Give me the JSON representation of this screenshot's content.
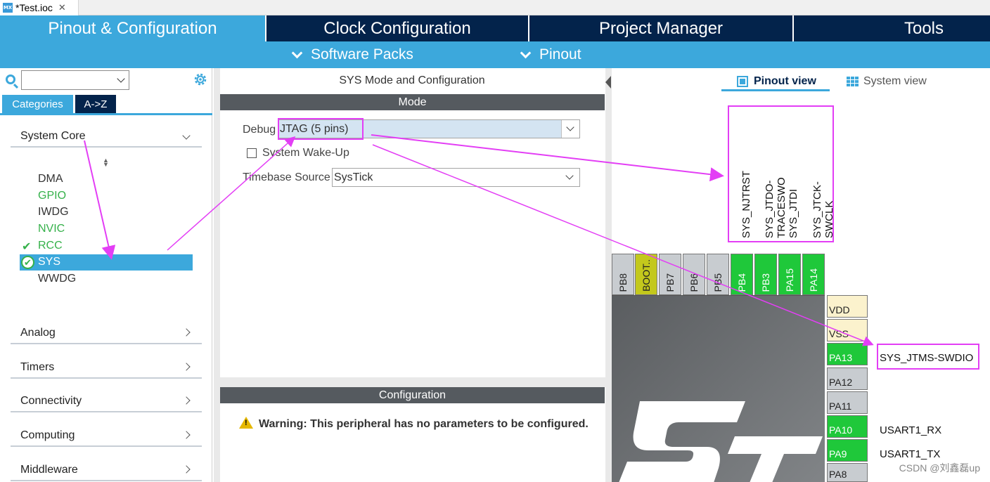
{
  "file_tab": {
    "icon": "mx-icon",
    "icon_text": "MX",
    "title": "*Test.ioc",
    "close": "✕"
  },
  "main_tabs": [
    {
      "label": "Pinout & Configuration",
      "active": true
    },
    {
      "label": "Clock Configuration",
      "active": false
    },
    {
      "label": "Project Manager",
      "active": false
    },
    {
      "label": "Tools",
      "active": false
    }
  ],
  "sub_nav": [
    {
      "label": "Software Packs",
      "icon": "chevron-down-icon"
    },
    {
      "label": "Pinout",
      "icon": "chevron-down-icon"
    }
  ],
  "left": {
    "search_value": "",
    "toggle_categories": "Categories",
    "toggle_az": "A->Z",
    "groups": [
      {
        "label": "System Core",
        "expanded": true
      },
      {
        "label": "Analog",
        "expanded": false
      },
      {
        "label": "Timers",
        "expanded": false
      },
      {
        "label": "Connectivity",
        "expanded": false
      },
      {
        "label": "Computing",
        "expanded": false
      },
      {
        "label": "Middleware",
        "expanded": false
      }
    ],
    "peripherals": [
      {
        "label": "DMA",
        "state": "plain"
      },
      {
        "label": "GPIO",
        "state": "green"
      },
      {
        "label": "IWDG",
        "state": "plain"
      },
      {
        "label": "NVIC",
        "state": "green"
      },
      {
        "label": "RCC",
        "state": "checked"
      },
      {
        "label": "SYS",
        "state": "selected"
      },
      {
        "label": "WWDG",
        "state": "plain"
      }
    ],
    "check_glyph": "✔"
  },
  "middle": {
    "title": "SYS Mode and Configuration",
    "mode_header": "Mode",
    "debug_label": "Debug",
    "debug_value": "JTAG (5 pins)",
    "wakeup_label": "System Wake-Up",
    "wakeup_checked": false,
    "timebase_label": "Timebase Source",
    "timebase_value": "SysTick",
    "config_header": "Configuration",
    "warning": "Warning: This peripheral has no parameters to be configured.",
    "warning_mark": "!"
  },
  "right": {
    "tab_pinout": "Pinout view",
    "tab_system": "System view",
    "top_signal_labels": [
      "SYS_NJTRST",
      "SYS_JTDO-TRACESWO",
      "SYS_JTDI",
      "SYS_JTCK-SWCLK"
    ],
    "top_pins": [
      {
        "label": "PB8",
        "color": "grey"
      },
      {
        "label": "BOOT..",
        "color": "olive"
      },
      {
        "label": "PB7",
        "color": "grey"
      },
      {
        "label": "PB6",
        "color": "grey"
      },
      {
        "label": "PB5",
        "color": "grey"
      },
      {
        "label": "PB4",
        "color": "green"
      },
      {
        "label": "PB3",
        "color": "green"
      },
      {
        "label": "PA15",
        "color": "green"
      },
      {
        "label": "PA14",
        "color": "green"
      }
    ],
    "right_pins": [
      {
        "label": "VDD",
        "color": "cream",
        "func": ""
      },
      {
        "label": "VSS",
        "color": "cream",
        "func": ""
      },
      {
        "label": "PA13",
        "color": "green",
        "func": "SYS_JTMS-SWDIO"
      },
      {
        "label": "PA12",
        "color": "grey",
        "func": ""
      },
      {
        "label": "PA11",
        "color": "grey",
        "func": ""
      },
      {
        "label": "PA10",
        "color": "green",
        "func": "USART1_RX"
      },
      {
        "label": "PA9",
        "color": "green",
        "func": "USART1_TX"
      },
      {
        "label": "PA8",
        "color": "grey",
        "func": ""
      }
    ],
    "logo_text": "ST",
    "watermark": "CSDN @刘鑫磊up"
  },
  "colors": {
    "nav_dark": "#03234b",
    "nav_blue": "#3ca8dc",
    "pin_green": "#1fc83a",
    "highlight": "#e33ef5"
  }
}
